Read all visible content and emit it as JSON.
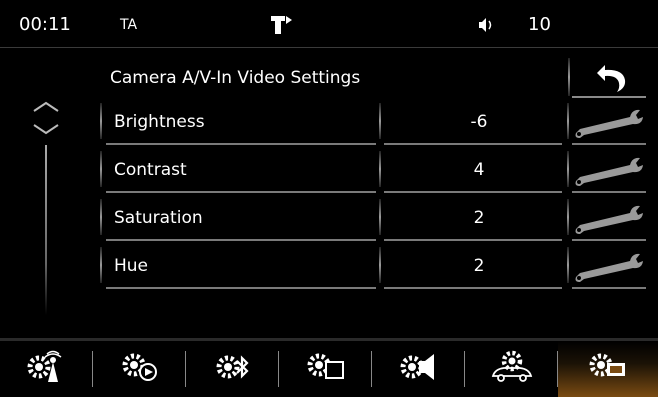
{
  "status": {
    "time": "00:11",
    "ta": "TA",
    "tp_icon": "traffic-program-icon",
    "volume_icon": "speaker-icon",
    "volume": "10"
  },
  "page": {
    "title": "Camera A/V-In Video Settings",
    "back_icon": "back-arrow-icon"
  },
  "settings": [
    {
      "label": "Brightness",
      "value": "-6",
      "icon": "wrench-icon"
    },
    {
      "label": "Contrast",
      "value": "4",
      "icon": "wrench-icon"
    },
    {
      "label": "Saturation",
      "value": "2",
      "icon": "wrench-icon"
    },
    {
      "label": "Hue",
      "value": "2",
      "icon": "wrench-icon"
    }
  ],
  "bottom_tabs": [
    {
      "icon": "gear-antenna-icon"
    },
    {
      "icon": "gear-play-icon"
    },
    {
      "icon": "gear-bluetooth-icon"
    },
    {
      "icon": "gear-display-icon"
    },
    {
      "icon": "gear-speaker-icon"
    },
    {
      "icon": "gear-car-icon"
    },
    {
      "icon": "gear-camera-icon",
      "active": true
    }
  ],
  "colors": {
    "background": "#000000",
    "separator": "#7a7a7a",
    "active_tab": "#7a4b12",
    "text": "#ffffff"
  }
}
